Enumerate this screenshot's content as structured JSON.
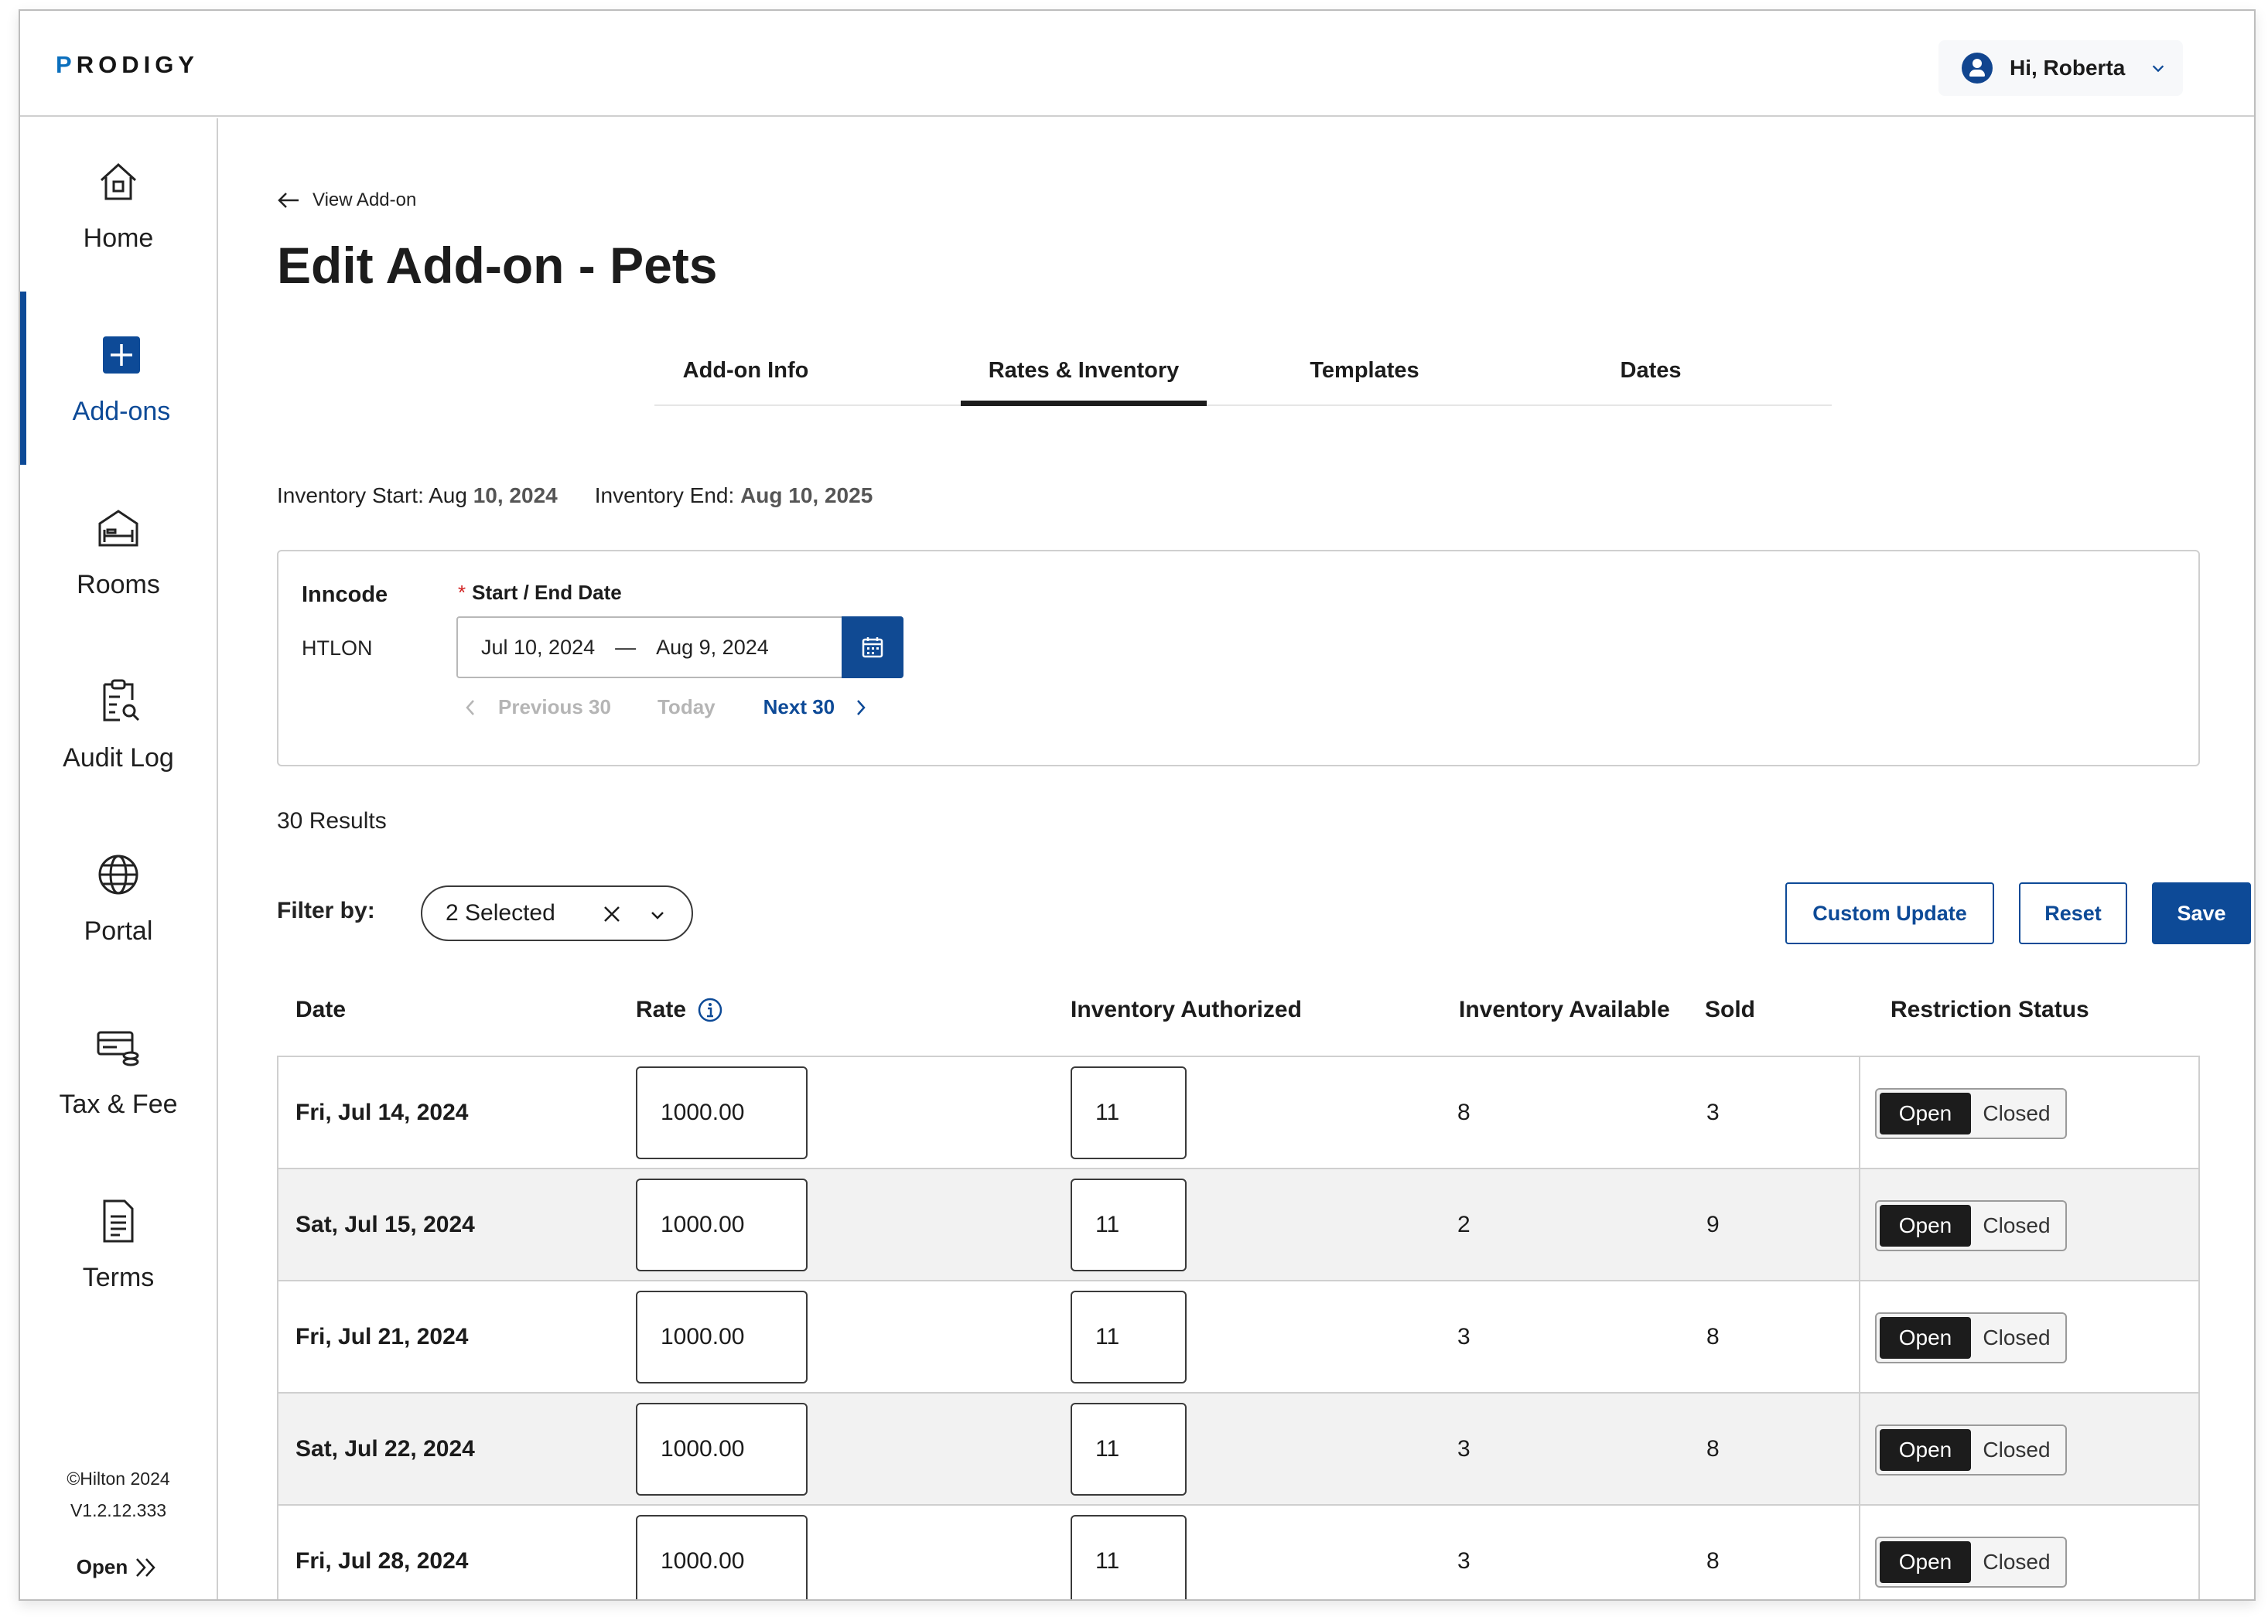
{
  "header": {
    "logo_prefix": "P",
    "logo_rest": "RODIGY",
    "greeting": "Hi, Roberta"
  },
  "sidebar": {
    "items": [
      {
        "label": "Home",
        "icon": "home-icon"
      },
      {
        "label": "Add-ons",
        "icon": "add-square-icon",
        "active": true
      },
      {
        "label": "Rooms",
        "icon": "bed-icon"
      },
      {
        "label": "Audit Log",
        "icon": "clipboard-search-icon"
      },
      {
        "label": "Portal",
        "icon": "globe-icon"
      },
      {
        "label": "Tax & Fee",
        "icon": "card-coins-icon"
      },
      {
        "label": "Terms",
        "icon": "document-icon"
      }
    ],
    "copyright": "©Hilton 2024",
    "version": "V1.2.12.333",
    "open_label": "Open"
  },
  "page": {
    "back_label": "View Add-on",
    "title": "Edit Add-on - Pets"
  },
  "tabs": [
    {
      "label": "Add-on Info",
      "active": false
    },
    {
      "label": "Rates & Inventory",
      "active": true
    },
    {
      "label": "Templates",
      "active": false
    },
    {
      "label": "Dates",
      "active": false
    }
  ],
  "inventory": {
    "start_label": "Inventory Start:",
    "start_prefix": "Aug",
    "start_value": "10, 2024",
    "end_label": "Inventory End:",
    "end_value": "Aug 10, 2025"
  },
  "search": {
    "inncode_label": "Inncode",
    "inncode_value": "HTLON",
    "date_label": "Start / End Date",
    "required_mark": "*",
    "start_date": "Jul 10, 2024",
    "separator": "—",
    "end_date": "Aug 9, 2024",
    "prev_label": "Previous 30",
    "today_label": "Today",
    "next_label": "Next 30"
  },
  "results": {
    "count_label": "30 Results"
  },
  "filter": {
    "label": "Filter by:",
    "value": "2 Selected"
  },
  "actions": {
    "custom_update": "Custom Update",
    "reset": "Reset",
    "save": "Save"
  },
  "table": {
    "columns": [
      "Date",
      "Rate",
      "Inventory Authorized",
      "Inventory Available",
      "Sold",
      "Restriction Status"
    ],
    "rows": [
      {
        "date": "Fri, Jul 14, 2024",
        "rate": "1000.00",
        "authorized": "11",
        "available": "8",
        "sold": "3",
        "status": "Open"
      },
      {
        "date": "Sat, Jul 15, 2024",
        "rate": "1000.00",
        "authorized": "11",
        "available": "2",
        "sold": "9",
        "status": "Open"
      },
      {
        "date": "Fri, Jul 21, 2024",
        "rate": "1000.00",
        "authorized": "11",
        "available": "3",
        "sold": "8",
        "status": "Open"
      },
      {
        "date": "Sat, Jul 22, 2024",
        "rate": "1000.00",
        "authorized": "11",
        "available": "3",
        "sold": "8",
        "status": "Open"
      },
      {
        "date": "Fri, Jul 28, 2024",
        "rate": "1000.00",
        "authorized": "11",
        "available": "3",
        "sold": "8",
        "status": "Open"
      }
    ],
    "status_open": "Open",
    "status_closed": "Closed"
  },
  "colors": {
    "brand_blue": "#0d4a97",
    "logo_blue": "#0b6fbd",
    "toggle_active": "#1c1c1c",
    "alt_row": "#f2f2f2"
  }
}
